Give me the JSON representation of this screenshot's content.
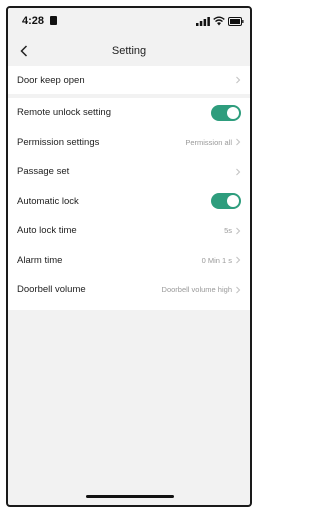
{
  "status_bar": {
    "time": "4:28"
  },
  "nav": {
    "title": "Setting"
  },
  "group_1": [
    {
      "label": "Door keep open",
      "value": ""
    }
  ],
  "group_2": [
    {
      "label": "Remote unlock setting",
      "toggle": true
    },
    {
      "label": "Permission settings",
      "value": "Permission all"
    },
    {
      "label": "Passage set",
      "value": ""
    },
    {
      "label": "Automatic lock",
      "toggle": true
    },
    {
      "label": "Auto lock time",
      "value": "5s"
    },
    {
      "label": "Alarm time",
      "value": "0 Min 1 s"
    },
    {
      "label": "Doorbell volume",
      "value": "Doorbell volume high"
    }
  ],
  "icons": {
    "back": "chevron-left-icon",
    "chevron": "chevron-right-icon",
    "signal": "cellular-signal-icon",
    "wifi": "wifi-icon",
    "battery": "battery-icon",
    "lock": "lock-icon"
  },
  "colors": {
    "toggle_on": "#2e9d7d",
    "background": "#f2f2f2",
    "card": "#ffffff",
    "value_text": "#9a9a9a"
  }
}
